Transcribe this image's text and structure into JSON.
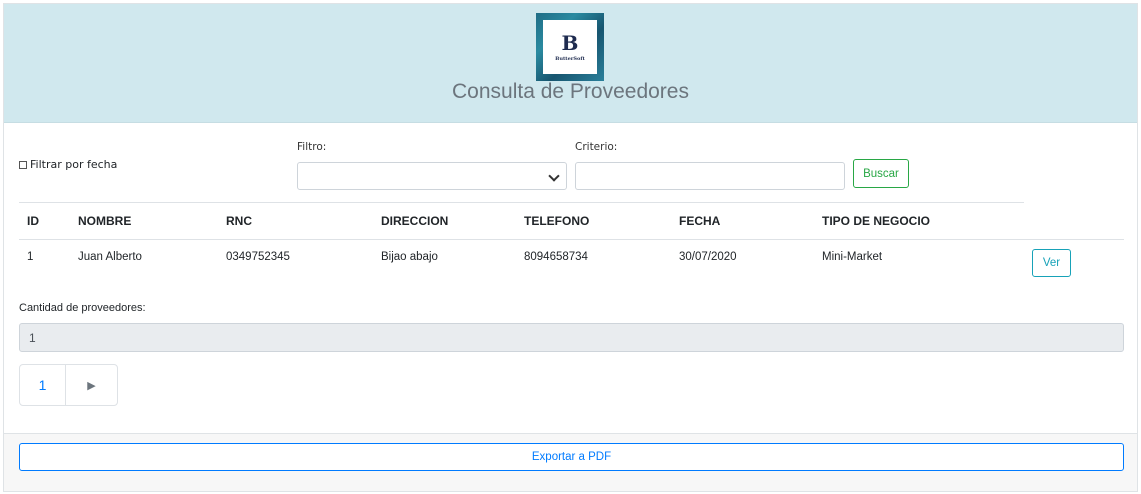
{
  "header": {
    "logo_letter": "B",
    "logo_text": "ButterSoft",
    "title": "Consulta de Proveedores"
  },
  "filters": {
    "date_filter_label": "Filtrar por fecha",
    "date_filter_checked": false,
    "filter_label": "Filtro:",
    "filter_value": "",
    "criteria_label": "Criterio:",
    "criteria_value": "",
    "search_button": "Buscar"
  },
  "table": {
    "columns": [
      "ID",
      "NOMBRE",
      "RNC",
      "DIRECCION",
      "TELEFONO",
      "FECHA",
      "TIPO DE NEGOCIO"
    ],
    "rows": [
      {
        "id": "1",
        "nombre": "Juan Alberto",
        "rnc": "0349752345",
        "direccion": "Bijao abajo",
        "telefono": "8094658734",
        "fecha": "30/07/2020",
        "tipo": "Mini-Market",
        "action": "Ver"
      }
    ]
  },
  "summary": {
    "count_label": "Cantidad de proveedores:",
    "count_value": "1"
  },
  "pagination": {
    "current_page": "1",
    "next_glyph": "▶"
  },
  "footer": {
    "export_button": "Exportar a PDF"
  },
  "colors": {
    "header_bg": "#d0e8ee",
    "success": "#28a745",
    "info": "#17a2b8",
    "primary": "#007bff"
  }
}
